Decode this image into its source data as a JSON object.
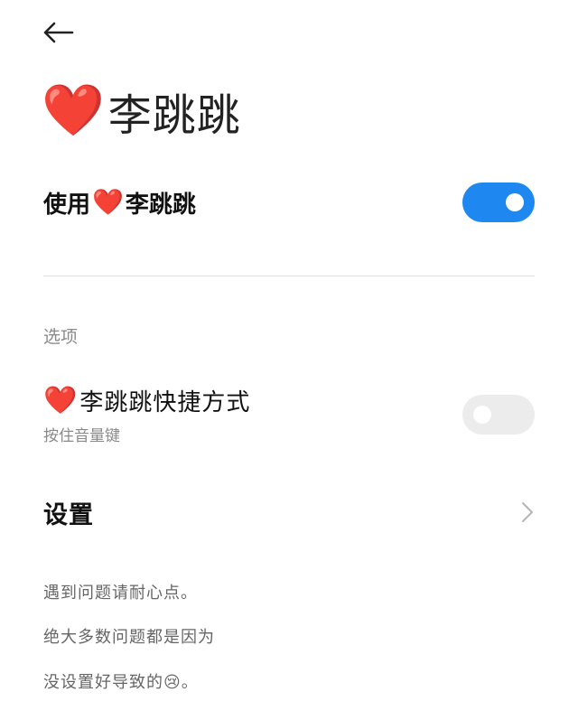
{
  "header": {
    "back_label": "",
    "title_heart": "❤️",
    "title": "李跳跳"
  },
  "main_toggle": {
    "label_prefix": "使用",
    "label_heart": "❤️",
    "label_suffix": "李跳跳",
    "state": "on"
  },
  "options": {
    "section_label": "选项",
    "shortcut": {
      "title_heart": "❤️",
      "title": "李跳跳快捷方式",
      "subtitle": "按住音量键",
      "state": "off"
    },
    "settings": {
      "label": "设置"
    }
  },
  "notes": [
    "遇到问题请耐心点。",
    "绝大多数问题都是因为",
    "没设置好导致的😢。"
  ],
  "colors": {
    "accent": "#1e88f0",
    "heart": "#f0645c",
    "switch_off": "#ececec",
    "secondary_text": "#8a8a8a"
  },
  "icons": {
    "back": "arrow-left-icon",
    "settings_chevron": "chevron-right-icon"
  }
}
